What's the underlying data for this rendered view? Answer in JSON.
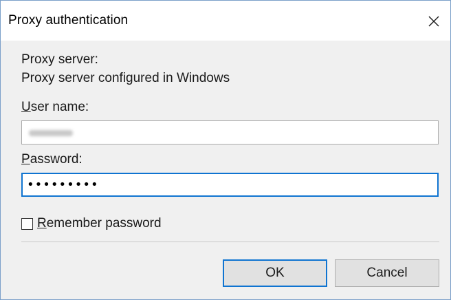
{
  "window": {
    "title": "Proxy authentication",
    "close_icon": "close-icon"
  },
  "proxy": {
    "label": "Proxy server:",
    "value": "Proxy server configured in Windows"
  },
  "username": {
    "label_mnemonic": "U",
    "label_rest": "ser name:"
  },
  "password": {
    "label_mnemonic": "P",
    "label_rest": "assword:",
    "masked_value": "•••••••••"
  },
  "remember": {
    "label_mnemonic": "R",
    "label_rest": "emember password",
    "checked": false
  },
  "buttons": {
    "ok": "OK",
    "cancel": "Cancel"
  },
  "colors": {
    "focus_border": "#0f74d1",
    "window_border": "#7a9fc9",
    "dialog_bg": "#f0f0f0"
  }
}
